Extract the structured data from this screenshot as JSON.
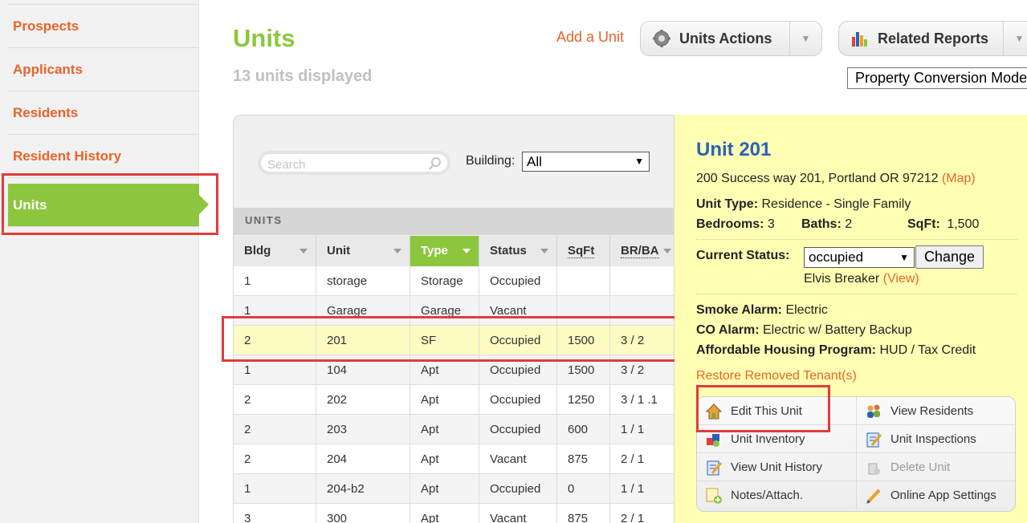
{
  "sidebar": {
    "items": [
      {
        "label": "Prospects"
      },
      {
        "label": "Applicants"
      },
      {
        "label": "Residents"
      },
      {
        "label": "Resident History"
      },
      {
        "label": "Units"
      }
    ],
    "active_index": 4
  },
  "header": {
    "title": "Units",
    "count_text": "13 units displayed",
    "add_unit_label": "Add a Unit",
    "units_actions_label": "Units Actions",
    "related_reports_label": "Related Reports",
    "property_select_value": "Property Conversion Mode"
  },
  "grid": {
    "search_placeholder": "Search",
    "building_label": "Building:",
    "building_value": "All",
    "section_label": "UNITS",
    "columns": [
      "Bldg",
      "Unit",
      "Type",
      "Status",
      "SqFt",
      "BR/BA"
    ],
    "sorted_column": "Type",
    "rows": [
      [
        "1",
        "storage",
        "Storage",
        "Occupied",
        "",
        ""
      ],
      [
        "1",
        "Garage",
        "Garage",
        "Vacant",
        "",
        ""
      ],
      [
        "2",
        "201",
        "SF",
        "Occupied",
        "1500",
        "3 / 2"
      ],
      [
        "1",
        "104",
        "Apt",
        "Occupied",
        "1500",
        "3 / 2"
      ],
      [
        "2",
        "202",
        "Apt",
        "Occupied",
        "1250",
        "3 / 1 .1"
      ],
      [
        "2",
        "203",
        "Apt",
        "Occupied",
        "600",
        "1 / 1"
      ],
      [
        "2",
        "204",
        "Apt",
        "Vacant",
        "875",
        "2 / 1"
      ],
      [
        "1",
        "204-b2",
        "Apt",
        "Occupied",
        "0",
        "1 / 1"
      ],
      [
        "3",
        "300",
        "Apt",
        "Vacant",
        "875",
        "2 / 1"
      ]
    ],
    "selected_row_index": 2
  },
  "detail": {
    "title": "Unit 201",
    "address": "200 Success way 201, Portland OR 97212",
    "map_link": "(Map)",
    "unit_type_label": "Unit Type:",
    "unit_type_value": "Residence - Single Family",
    "bedrooms_label": "Bedrooms:",
    "bedrooms_value": "3",
    "baths_label": "Baths:",
    "baths_value": "2",
    "sqft_label": "SqFt:",
    "sqft_value": "1,500",
    "status_label": "Current Status:",
    "status_value": "occupied",
    "change_label": "Change",
    "resident_name": "Elvis Breaker",
    "view_link": "(View)",
    "smoke_label": "Smoke Alarm:",
    "smoke_value": "Electric",
    "co_label": "CO Alarm:",
    "co_value": "Electric w/ Battery Backup",
    "housing_label": "Affordable Housing Program:",
    "housing_value": "HUD / Tax Credit",
    "restore_link": "Restore Removed Tenant(s)",
    "actions": [
      {
        "label": "Edit This Unit",
        "icon": "house-icon"
      },
      {
        "label": "View Residents",
        "icon": "people-icon"
      },
      {
        "label": "Unit Inventory",
        "icon": "inventory-icon"
      },
      {
        "label": "Unit Inspections",
        "icon": "clipboard-pencil-icon"
      },
      {
        "label": "View Unit History",
        "icon": "history-pencil-icon"
      },
      {
        "label": "Delete Unit",
        "icon": "delete-icon",
        "disabled": true
      },
      {
        "label": "Notes/Attach.",
        "icon": "notes-add-icon"
      },
      {
        "label": "Online App Settings",
        "icon": "pencil-icon"
      }
    ]
  },
  "colors": {
    "accent_green": "#8cc63f",
    "link_orange": "#e8642a",
    "title_blue": "#2a62b8",
    "detail_bg": "#ffffb4",
    "highlight_red": "#e03c3c"
  }
}
